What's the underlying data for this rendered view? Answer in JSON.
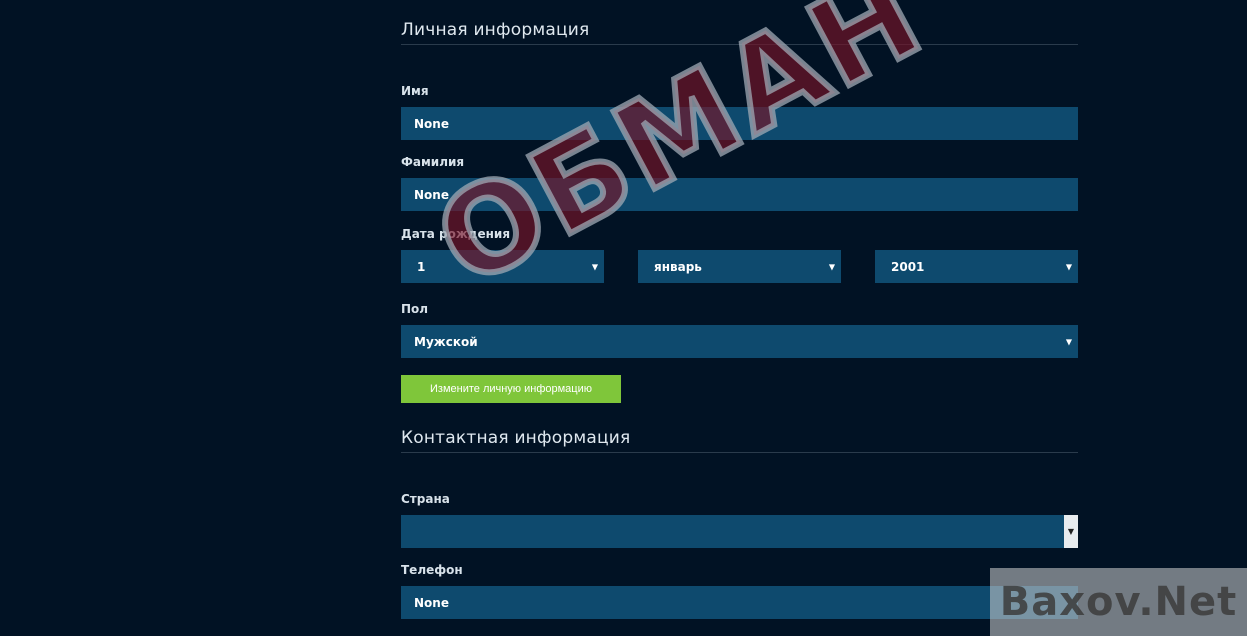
{
  "personal": {
    "title": "Личная информация",
    "first_name_label": "Имя",
    "first_name_value": "None",
    "last_name_label": "Фамилия",
    "last_name_value": "None",
    "dob_label": "Дата рождения",
    "dob_day": "1",
    "dob_month": "январь",
    "dob_year": "2001",
    "gender_label": "Пол",
    "gender_value": "Мужской",
    "submit_label": "Измените личную информацию"
  },
  "contact": {
    "title": "Контактная информация",
    "country_label": "Страна",
    "country_value": "",
    "phone_label": "Телефон",
    "phone_value": "None"
  },
  "overlay": {
    "stamp_text": "ОБМАН",
    "watermark_text": "Baxov.Net"
  },
  "colors": {
    "background": "#011224",
    "field": "#0e4a6e",
    "button": "#7fc63a"
  },
  "icons": {
    "select_arrow": "chevron-down-icon"
  }
}
